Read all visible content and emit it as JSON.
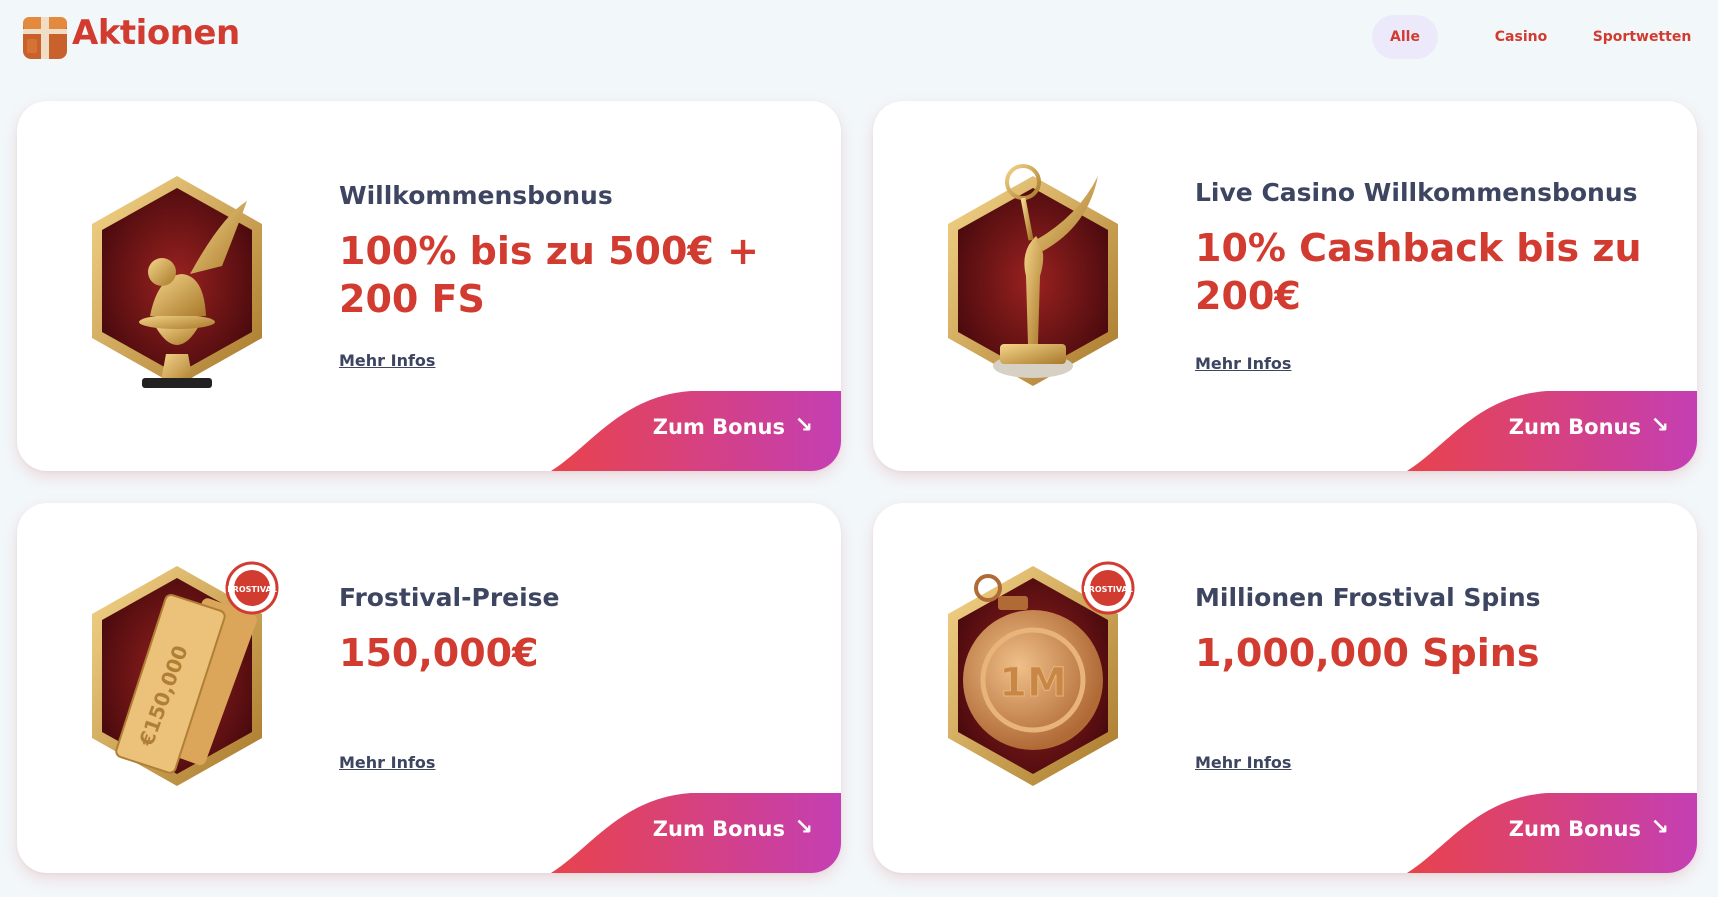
{
  "header": {
    "title": "Aktionen",
    "logo_icon": "gift-box-icon"
  },
  "filters": [
    {
      "label": "Alle",
      "active": true
    },
    {
      "label": "Casino",
      "active": false
    },
    {
      "label": "Sportwetten",
      "active": false
    }
  ],
  "cards": [
    {
      "title": "Willkommensbonus",
      "value": "100% bis zu 500€ + 200 FS",
      "more_label": "Mehr Infos",
      "cta_label": "Zum Bonus",
      "icon": "winged-lion-trophy-icon"
    },
    {
      "title": "Live Casino Willkommensbonus",
      "value": "10% Cashback bis zu 200€",
      "more_label": "Mehr Infos",
      "cta_label": "Zum Bonus",
      "icon": "statuette-trophy-icon"
    },
    {
      "title": "Frostival-Preise",
      "value": "150,000€",
      "more_label": "Mehr Infos",
      "cta_label": "Zum Bonus",
      "icon": "tickets-icon",
      "badge_text": "€150,000",
      "tag": "FROSTIVAL"
    },
    {
      "title": "Millionen Frostival Spins",
      "value": "1,000,000 Spins",
      "more_label": "Mehr Infos",
      "cta_label": "Zum Bonus",
      "icon": "ornament-coin-icon",
      "badge_text": "1M",
      "tag": "FROSTIVAL"
    }
  ],
  "colors": {
    "accent": "#d23b30",
    "text_dark": "#3d4560",
    "cta_gradient_start": "#e8434c",
    "cta_gradient_end": "#c43fb3",
    "badge_inner": "#6a0f12",
    "gold": "#d8a85a",
    "page_bg": "#f2f7fa"
  }
}
